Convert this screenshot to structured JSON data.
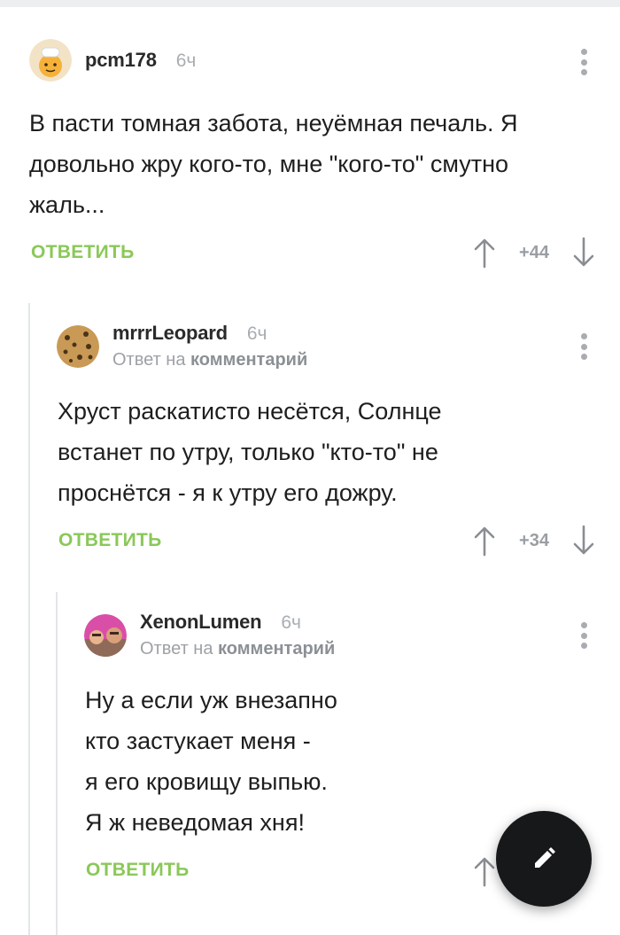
{
  "comments": [
    {
      "username": "pcm178",
      "time": "6ч",
      "text": "В пасти томная забота, неуёмная печаль. Я\nдовольно жру кого-то, мне \"кого-то\" смутно\nжаль...",
      "reply_label": "ОТВЕТИТЬ",
      "rating": "+44",
      "avatar_icon": "chef-emoji-avatar"
    },
    {
      "username": "mrrrLeopard",
      "time": "6ч",
      "reply_prefix": "Ответ на",
      "reply_target": "комментарий",
      "text": "Хруст раскатисто несётся, Солнце\nвстанет по утру, только \"кто-то\" не\nпроснётся - я к утру его дожру.",
      "reply_label": "ОТВЕТИТЬ",
      "rating": "+34",
      "avatar_icon": "leopard-avatar"
    },
    {
      "username": "XenonLumen",
      "time": "6ч",
      "reply_prefix": "Ответ на",
      "reply_target": "комментарий",
      "text": "Ну а если уж внезапно\nкто застукает меня -\nя его кровищу выпью.\nЯ ж неведомая хня!",
      "reply_label": "ОТВЕТИТЬ",
      "avatar_icon": "photo-avatar"
    }
  ],
  "colors": {
    "accent_green": "#8ac858",
    "muted_grey": "#a9adb2",
    "fab_background": "#161819"
  },
  "fab": {
    "icon": "pencil-icon"
  }
}
